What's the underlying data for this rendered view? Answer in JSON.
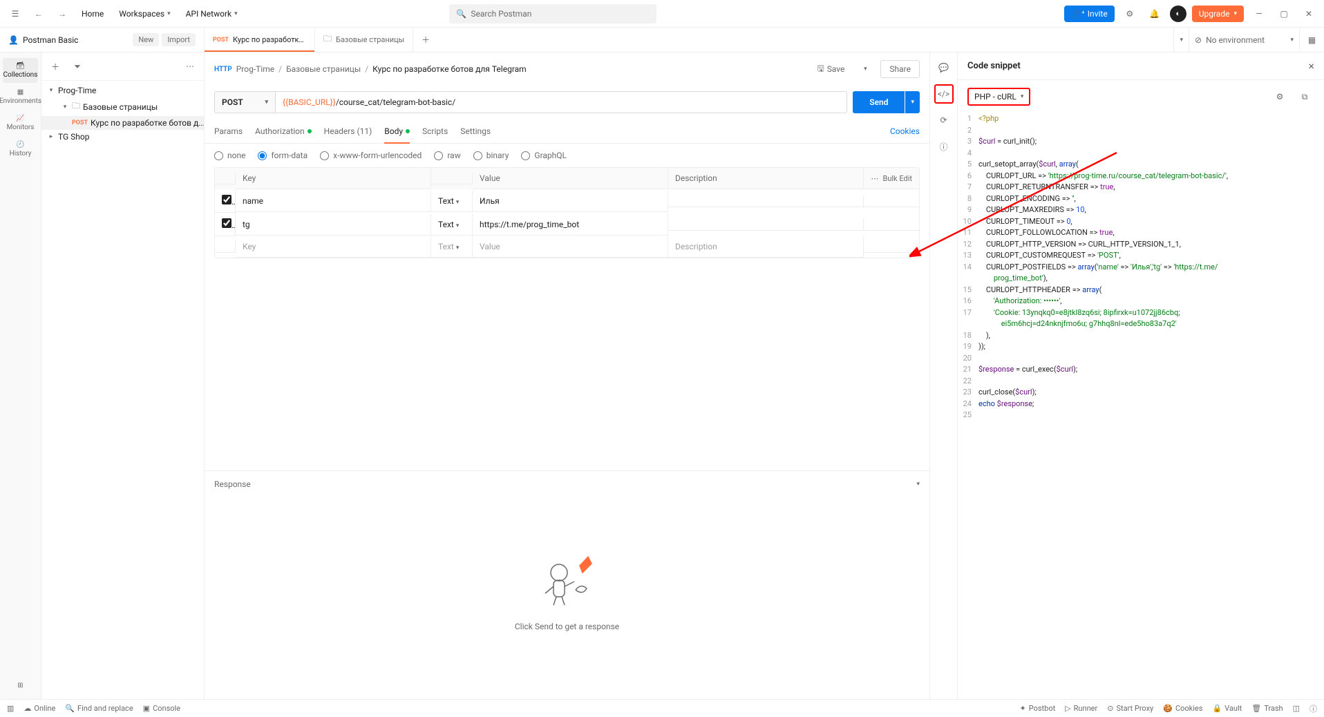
{
  "topnav": {
    "home": "Home",
    "workspaces": "Workspaces",
    "api_network": "API Network",
    "search_placeholder": "Search Postman",
    "invite": "Invite",
    "upgrade": "Upgrade"
  },
  "workspace": {
    "name": "Postman Basic",
    "new": "New",
    "import": "Import"
  },
  "tabs": [
    {
      "method": "POST",
      "label": "Курс по разработке бо"
    },
    {
      "method": "",
      "label": "Базовые страницы"
    }
  ],
  "env": {
    "selected": "No environment"
  },
  "rail": {
    "collections": "Collections",
    "environments": "Environments",
    "monitors": "Monitors",
    "history": "History"
  },
  "tree": {
    "root1": "Prog-Time",
    "folder1": "Базовые страницы",
    "req1_method": "POST",
    "req1": "Курс по разработке ботов д...",
    "root2": "TG Shop"
  },
  "breadcrumb": {
    "a": "Prog-Time",
    "b": "Базовые страницы",
    "c": "Курс по разработке ботов для Telegram",
    "save": "Save",
    "share": "Share"
  },
  "request": {
    "method": "POST",
    "url_var": "{{BASIC_URL}}",
    "url_rest": "/course_cat/telegram-bot-basic/",
    "send": "Send"
  },
  "reqtabs": {
    "params": "Params",
    "auth": "Authorization",
    "headers": "Headers (11)",
    "body": "Body",
    "scripts": "Scripts",
    "settings": "Settings",
    "cookies": "Cookies"
  },
  "bodytypes": {
    "none": "none",
    "formdata": "form-data",
    "urlenc": "x-www-form-urlencoded",
    "raw": "raw",
    "binary": "binary",
    "graphql": "GraphQL"
  },
  "kv": {
    "h_key": "Key",
    "h_val": "Value",
    "h_desc": "Description",
    "h_bulk": "Bulk Edit",
    "rows": [
      {
        "key": "name",
        "type": "Text",
        "value": "Илья",
        "desc": ""
      },
      {
        "key": "tg",
        "type": "Text",
        "value": "https://t.me/prog_time_bot",
        "desc": ""
      }
    ],
    "ph_key": "Key",
    "ph_type": "Text",
    "ph_val": "Value",
    "ph_desc": "Description"
  },
  "response": {
    "title": "Response",
    "empty_msg": "Click Send to get a response"
  },
  "snippet": {
    "title": "Code snippet",
    "lang": "PHP - cURL",
    "code": [
      {
        "n": 1,
        "h": "<span class='tk-meta'>&lt;?php</span>"
      },
      {
        "n": 2,
        "h": ""
      },
      {
        "n": 3,
        "h": "<span class='tk-var'>$curl</span> = <span class='tk-fn'>curl_init</span>();"
      },
      {
        "n": 4,
        "h": ""
      },
      {
        "n": 5,
        "h": "<span class='tk-fn'>curl_setopt_array</span>(<span class='tk-var'>$curl</span>, <span class='tk-kw'>array</span>("
      },
      {
        "n": 6,
        "h": "    CURLOPT_URL =&gt; <span class='tk-str'>'https://prog-time.ru/course_cat/telegram-bot-basic/'</span>,"
      },
      {
        "n": 7,
        "h": "    CURLOPT_RETURNTRANSFER =&gt; <span class='tk-const'>true</span>,"
      },
      {
        "n": 8,
        "h": "    CURLOPT_ENCODING =&gt; <span class='tk-str'>''</span>,"
      },
      {
        "n": 9,
        "h": "    CURLOPT_MAXREDIRS =&gt; <span class='tk-num'>10</span>,"
      },
      {
        "n": 10,
        "h": "    CURLOPT_TIMEOUT =&gt; <span class='tk-num'>0</span>,"
      },
      {
        "n": 11,
        "h": "    CURLOPT_FOLLOWLOCATION =&gt; <span class='tk-const'>true</span>,"
      },
      {
        "n": 12,
        "h": "    CURLOPT_HTTP_VERSION =&gt; CURL_HTTP_VERSION_1_1,"
      },
      {
        "n": 13,
        "h": "    CURLOPT_CUSTOMREQUEST =&gt; <span class='tk-str'>'POST'</span>,"
      },
      {
        "n": 14,
        "h": "    CURLOPT_POSTFIELDS =&gt; <span class='tk-kw'>array</span>(<span class='tk-str'>'name'</span> =&gt; <span class='tk-str'>'Илья'</span>,<span class='tk-str'>'tg'</span> =&gt; <span class='tk-str'>'https://t.me/</span>"
      },
      {
        "n": "",
        "h": "        <span class='tk-str'>prog_time_bot'</span>),"
      },
      {
        "n": 15,
        "h": "    CURLOPT_HTTPHEADER =&gt; <span class='tk-kw'>array</span>("
      },
      {
        "n": 16,
        "h": "        <span class='tk-str'>'Authorization: ••••••'</span>,"
      },
      {
        "n": 17,
        "h": "        <span class='tk-str'>'Cookie: 13ynqkq0=e8jtkl8zq6si; 8ipfirxk=u1072jj86cbq;</span>"
      },
      {
        "n": "",
        "h": "            <span class='tk-str'>ei5m6hcj=d24nknjfmo6u; g7hhq8nl=ede5ho83a7q2'</span>"
      },
      {
        "n": 18,
        "h": "    ),"
      },
      {
        "n": 19,
        "h": "));"
      },
      {
        "n": 20,
        "h": ""
      },
      {
        "n": 21,
        "h": "<span class='tk-var'>$response</span> = <span class='tk-fn'>curl_exec</span>(<span class='tk-var'>$curl</span>);"
      },
      {
        "n": 22,
        "h": ""
      },
      {
        "n": 23,
        "h": "<span class='tk-fn'>curl_close</span>(<span class='tk-var'>$curl</span>);"
      },
      {
        "n": 24,
        "h": "<span class='tk-kw'>echo</span> <span class='tk-var'>$response</span>;"
      },
      {
        "n": 25,
        "h": ""
      }
    ]
  },
  "status": {
    "online": "Online",
    "find": "Find and replace",
    "console": "Console",
    "postbot": "Postbot",
    "runner": "Runner",
    "proxy": "Start Proxy",
    "cookies": "Cookies",
    "vault": "Vault",
    "trash": "Trash"
  }
}
